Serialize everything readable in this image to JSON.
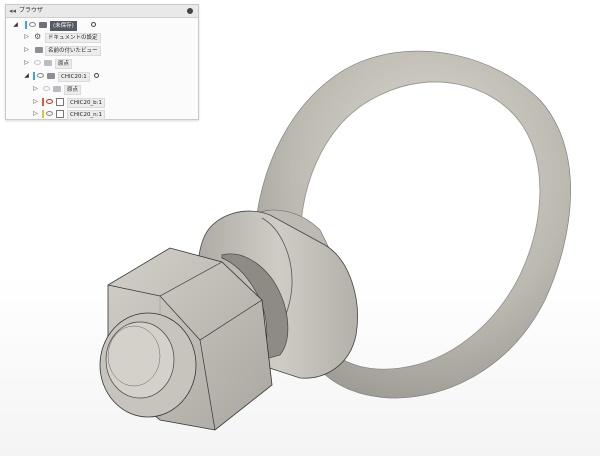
{
  "browser": {
    "title": "ブラウザ",
    "root_label": "(未保存)",
    "items": [
      {
        "label": "ドキュメントの設定"
      },
      {
        "label": "名前の付いたビュー"
      },
      {
        "label": "原点"
      },
      {
        "label": "CHIC20:1"
      },
      {
        "label": "原点"
      },
      {
        "label": "CHIC20_b:1"
      },
      {
        "label": "CHIC20_n:1"
      }
    ]
  },
  "colors": {
    "part_body": "#c2bfb7",
    "part_edge": "#3a3a3a",
    "body_bar": "#e05a3a",
    "nut_bar": "#e6c233",
    "root_bar": "#3aa7d8"
  }
}
